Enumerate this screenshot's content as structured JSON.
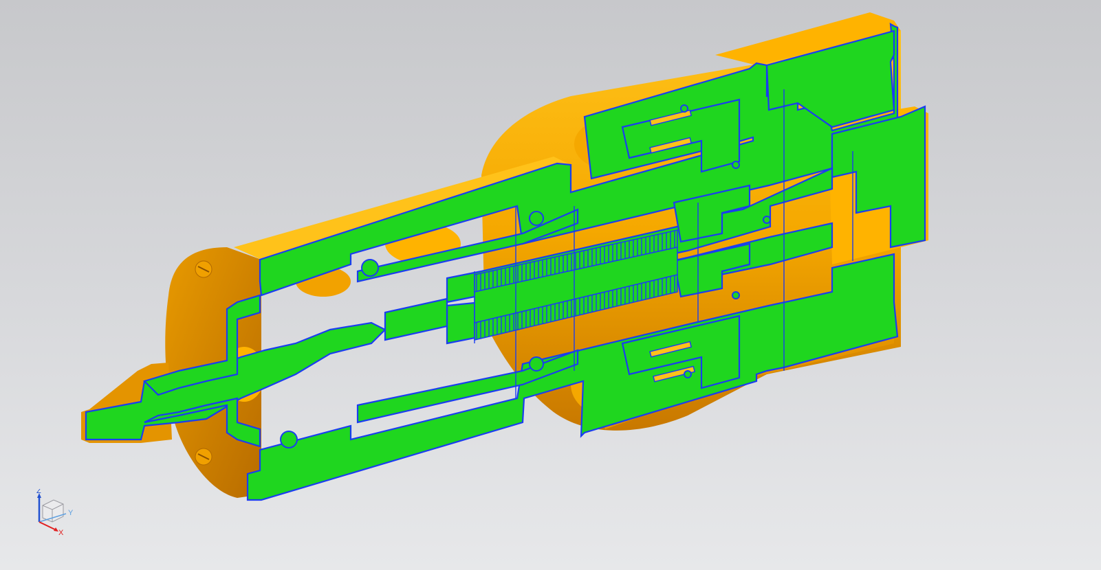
{
  "app": {
    "view": "section-view"
  },
  "colors": {
    "background_top": "#c7c8cb",
    "background_bottom": "#e7e8ea",
    "section_fill": "#1fd61f",
    "section_edge": "#1a3df0",
    "body_orange": "#f5a800",
    "body_shadow": "#c87800",
    "body_highlight": "#ffc21a",
    "axis_x": "#e02020",
    "axis_y": "#5fa0e0",
    "axis_z": "#2050d0"
  },
  "triad": {
    "z_label": "Z",
    "y_label": "Y",
    "x_label": "X",
    "icon": "view-cube-icon"
  }
}
